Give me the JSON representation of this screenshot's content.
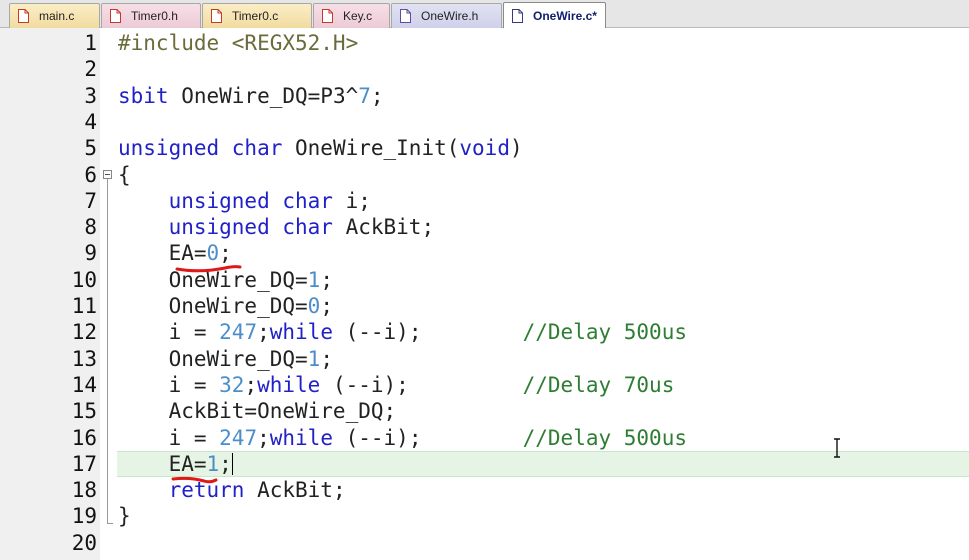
{
  "tabs": [
    {
      "label": "main.c",
      "kind": "c"
    },
    {
      "label": "Timer0.h",
      "kind": "h"
    },
    {
      "label": "Timer0.c",
      "kind": "c"
    },
    {
      "label": "Key.c",
      "kind": "h"
    },
    {
      "label": "OneWire.h",
      "kind": "hl"
    },
    {
      "label": "OneWire.c*",
      "kind": "active"
    }
  ],
  "active_line": 17,
  "lines": [
    {
      "n": "1",
      "segs": [
        [
          "pp",
          "#include <REGX52.H>"
        ]
      ]
    },
    {
      "n": "2",
      "segs": []
    },
    {
      "n": "3",
      "segs": [
        [
          "kw",
          "sbit"
        ],
        [
          "",
          " OneWire_DQ=P3^"
        ],
        [
          "num",
          "7"
        ],
        [
          "",
          ";"
        ]
      ]
    },
    {
      "n": "4",
      "segs": []
    },
    {
      "n": "5",
      "segs": [
        [
          "kw",
          "unsigned char"
        ],
        [
          "",
          " OneWire_Init("
        ],
        [
          "kw",
          "void"
        ],
        [
          "",
          ")"
        ]
      ]
    },
    {
      "n": "6",
      "segs": [
        [
          "",
          "{"
        ]
      ]
    },
    {
      "n": "7",
      "segs": [
        [
          "",
          "    "
        ],
        [
          "kw",
          "unsigned char"
        ],
        [
          "",
          " i;"
        ]
      ]
    },
    {
      "n": "8",
      "segs": [
        [
          "",
          "    "
        ],
        [
          "kw",
          "unsigned char"
        ],
        [
          "",
          " AckBit;"
        ]
      ]
    },
    {
      "n": "9",
      "segs": [
        [
          "",
          "    EA="
        ],
        [
          "num",
          "0"
        ],
        [
          "",
          ";"
        ]
      ]
    },
    {
      "n": "10",
      "segs": [
        [
          "",
          "    OneWire_DQ="
        ],
        [
          "num",
          "1"
        ],
        [
          "",
          ";"
        ]
      ]
    },
    {
      "n": "11",
      "segs": [
        [
          "",
          "    OneWire_DQ="
        ],
        [
          "num",
          "0"
        ],
        [
          "",
          ";"
        ]
      ]
    },
    {
      "n": "12",
      "segs": [
        [
          "",
          "    i = "
        ],
        [
          "num",
          "247"
        ],
        [
          "",
          ";"
        ],
        [
          "kw",
          "while"
        ],
        [
          "",
          " (--i);        "
        ],
        [
          "cm",
          "//Delay 500us"
        ]
      ]
    },
    {
      "n": "13",
      "segs": [
        [
          "",
          "    OneWire_DQ="
        ],
        [
          "num",
          "1"
        ],
        [
          "",
          ";"
        ]
      ]
    },
    {
      "n": "14",
      "segs": [
        [
          "",
          "    i = "
        ],
        [
          "num",
          "32"
        ],
        [
          "",
          ";"
        ],
        [
          "kw",
          "while"
        ],
        [
          "",
          " (--i);         "
        ],
        [
          "cm",
          "//Delay 70us"
        ]
      ]
    },
    {
      "n": "15",
      "segs": [
        [
          "",
          "    AckBit=OneWire_DQ;"
        ]
      ]
    },
    {
      "n": "16",
      "segs": [
        [
          "",
          "    i = "
        ],
        [
          "num",
          "247"
        ],
        [
          "",
          ";"
        ],
        [
          "kw",
          "while"
        ],
        [
          "",
          " (--i);        "
        ],
        [
          "cm",
          "//Delay 500us"
        ]
      ]
    },
    {
      "n": "17",
      "segs": [
        [
          "",
          "    EA="
        ],
        [
          "num",
          "1"
        ],
        [
          "",
          ";"
        ]
      ]
    },
    {
      "n": "18",
      "segs": [
        [
          "",
          "    "
        ],
        [
          "kw",
          "return"
        ],
        [
          "",
          " AckBit;"
        ]
      ]
    },
    {
      "n": "19",
      "segs": [
        [
          "",
          "}"
        ]
      ]
    },
    {
      "n": "20",
      "segs": []
    }
  ],
  "colors": {
    "keyword": "#2121c8",
    "number": "#4c8ec9",
    "preprocessor": "#6b6b3c",
    "comment": "#2e7d32",
    "annotation": "#e01818",
    "current_line": "#e6f4e6"
  },
  "icons": {
    "tab": "file-icon",
    "fold": "fold-minus-icon",
    "cursor": "ibeam-cursor-icon"
  }
}
